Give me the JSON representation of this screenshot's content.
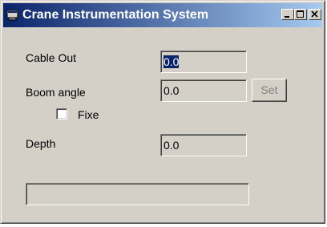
{
  "window": {
    "title": "Crane Instrumentation System",
    "title_gradient_start": "#0a246a",
    "title_gradient_end": "#a6caf0",
    "app_icon": "crane-app-icon"
  },
  "caption_buttons": {
    "minimize_icon": "minimize-icon",
    "maximize_icon": "maximize-icon",
    "close_icon": "close-icon"
  },
  "fields": {
    "cable_out": {
      "label": "Cable Out",
      "value": "0.0"
    },
    "boom_angle": {
      "label": "Boom angle",
      "value": "0.0"
    },
    "depth": {
      "label": "Depth",
      "value": "0.0"
    }
  },
  "set_button": {
    "label": "Set",
    "enabled": false
  },
  "fixed_checkbox": {
    "label": "Fixe",
    "checked": false
  },
  "status": {
    "text": ""
  }
}
